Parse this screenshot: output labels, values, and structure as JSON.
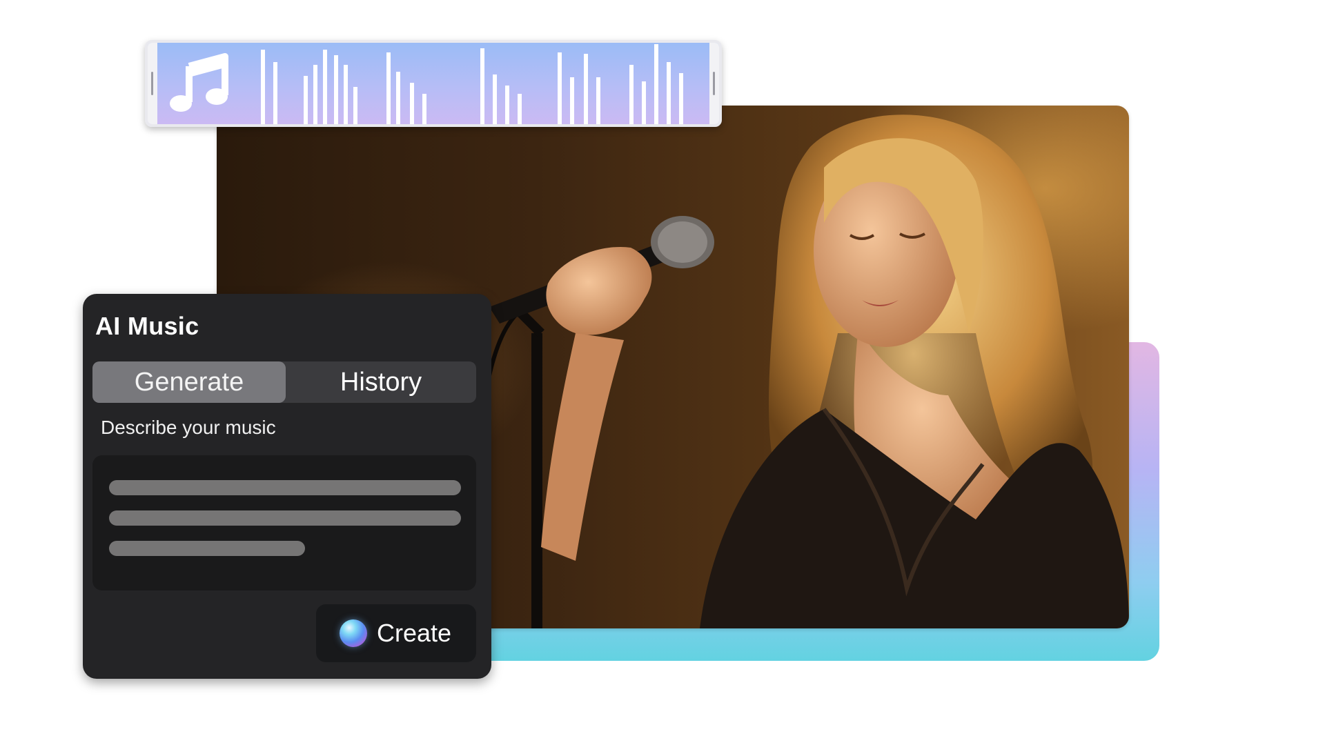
{
  "panel": {
    "title": "AI Music",
    "tabs": [
      {
        "label": "Generate",
        "active": true
      },
      {
        "label": "History",
        "active": false
      }
    ],
    "field_label": "Describe your music",
    "create_label": "Create"
  },
  "waveform": {
    "icon": "music-note-icon",
    "gradient_top": "#9bbcf6",
    "gradient_bottom": "#cbbaf3"
  },
  "colors": {
    "panel_bg": "#242426",
    "tab_active": "#78787c",
    "backdrop_top": "#e2b7e3",
    "backdrop_bottom": "#63d2e1"
  }
}
